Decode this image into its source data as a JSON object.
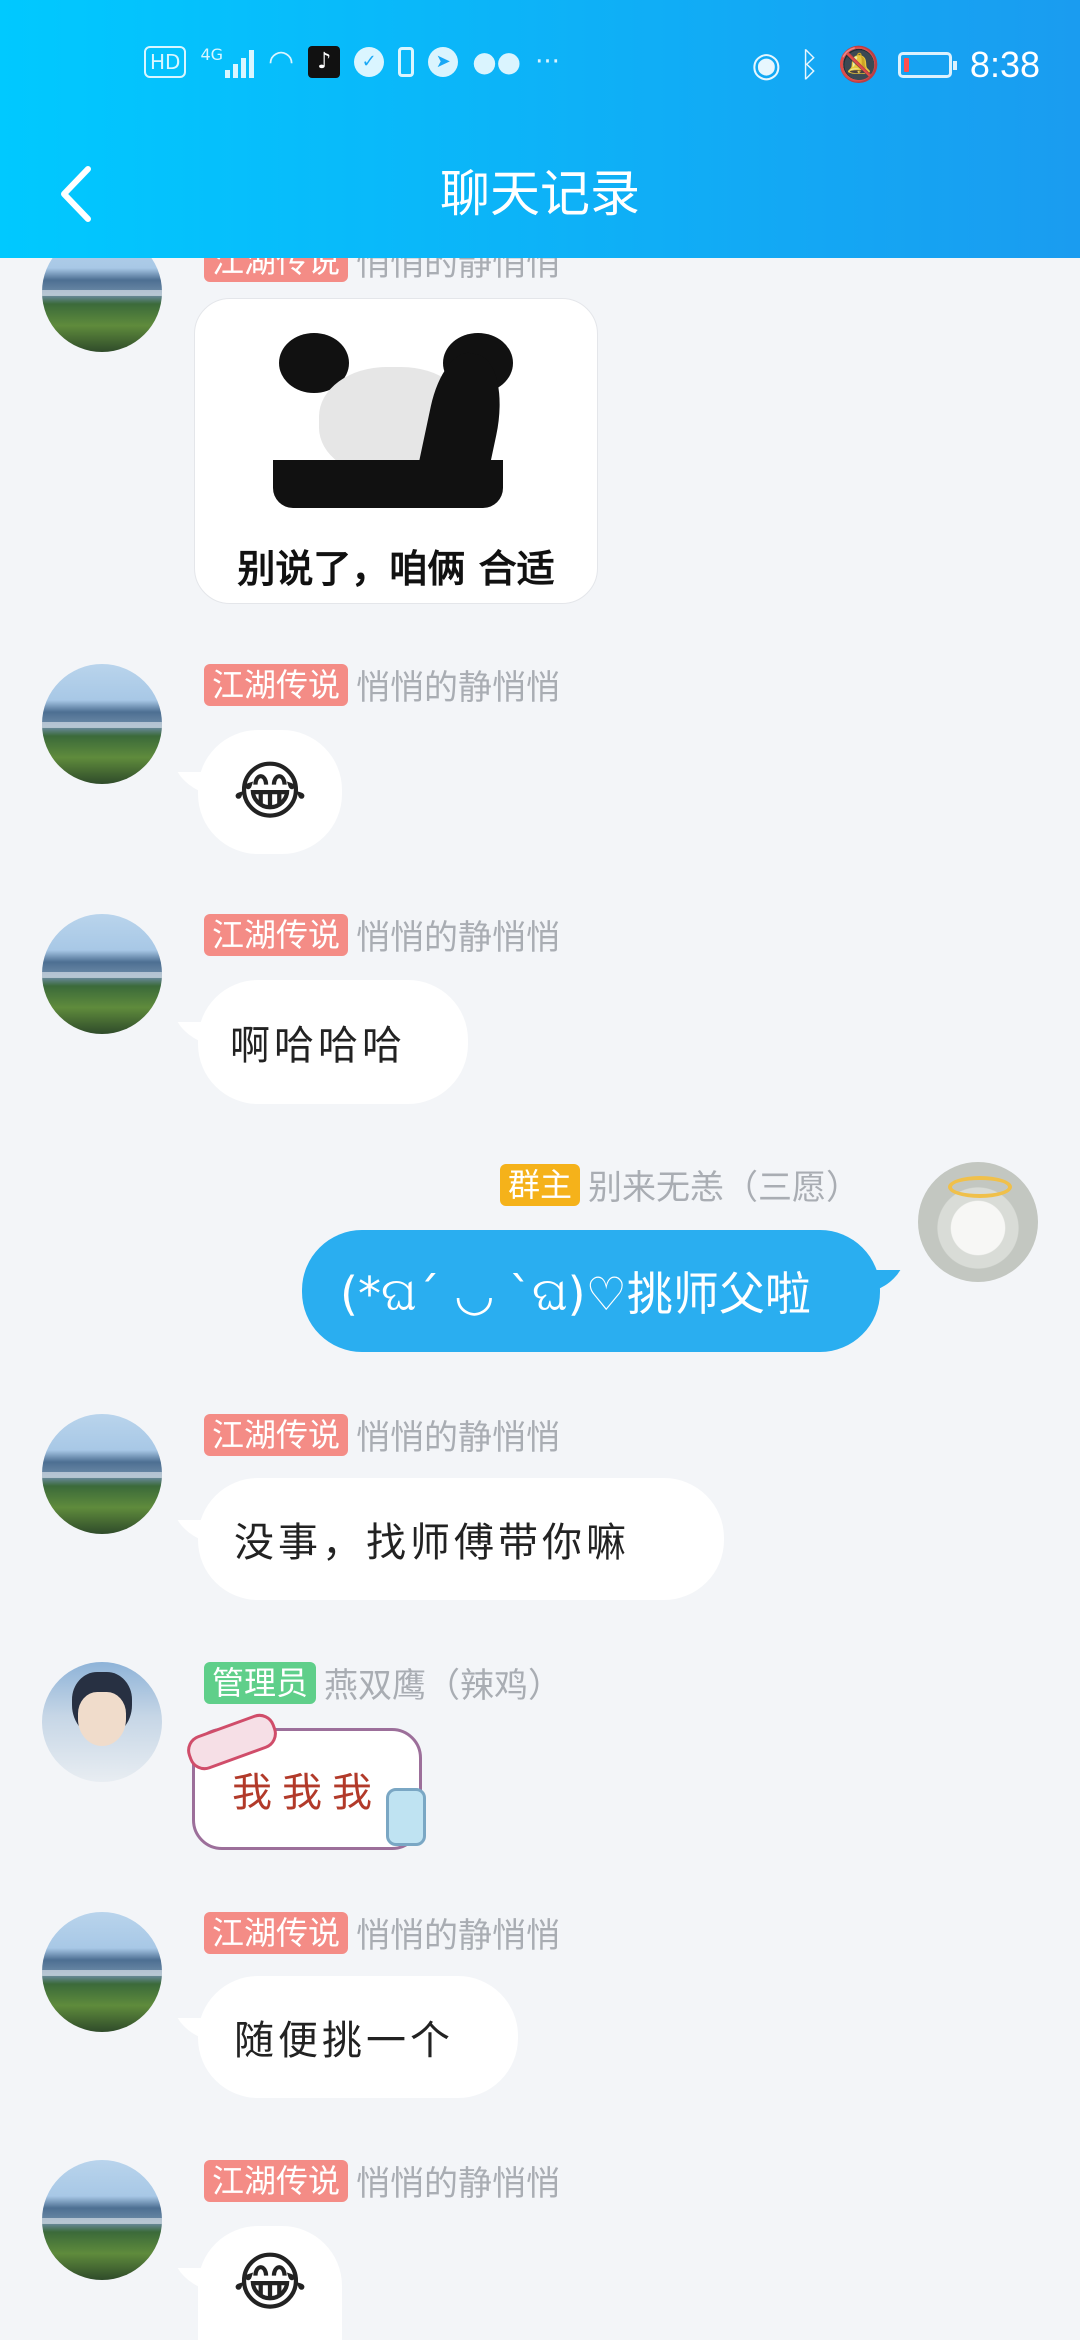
{
  "status_bar": {
    "left_icons": [
      "hd-icon",
      "4g-signal-icon",
      "wifi-icon",
      "tiktok-icon",
      "shield-icon",
      "sim-icon",
      "notification-icon",
      "wechat-icon",
      "more-icon"
    ],
    "hd": "HD",
    "net": "4G",
    "more": "···",
    "right_icons": [
      "eye-icon",
      "bluetooth-icon",
      "mute-bell-icon",
      "battery-icon"
    ],
    "time": "8:38"
  },
  "nav": {
    "title": "聊天记录"
  },
  "messages": [
    {
      "tag": "江湖传说",
      "name": "悄悄的静悄悄",
      "type": "sticker",
      "caption": "别说了，咱俩  合适"
    },
    {
      "tag": "江湖传说",
      "name": "悄悄的静悄悄",
      "type": "emoji",
      "text": "😂"
    },
    {
      "tag": "江湖传说",
      "name": "悄悄的静悄悄",
      "type": "text",
      "text": "啊哈哈哈"
    },
    {
      "tag": "群主",
      "name": "别来无恙（三愿）",
      "type": "text",
      "text": "(*ଘ´ ◡ `ଘ)♡挑师父啦",
      "side": "right"
    },
    {
      "tag": "江湖传说",
      "name": "悄悄的静悄悄",
      "type": "text",
      "text": "没事，找师傅带你嘛"
    },
    {
      "tag": "管理员",
      "name": "燕双鹰（辣鸡）",
      "type": "sticker",
      "text": "我我我"
    },
    {
      "tag": "江湖传说",
      "name": "悄悄的静悄悄",
      "type": "text",
      "text": "随便挑一个"
    },
    {
      "tag": "江湖传说",
      "name": "悄悄的静悄悄",
      "type": "emoji",
      "text": "😂"
    }
  ],
  "colors": {
    "header_start": "#00c9ff",
    "header_end": "#1a9cf0",
    "self_bubble": "#2aaef0",
    "tag_red": "#f48c86",
    "tag_gold": "#f5b21a",
    "tag_green": "#5fcf8a"
  }
}
